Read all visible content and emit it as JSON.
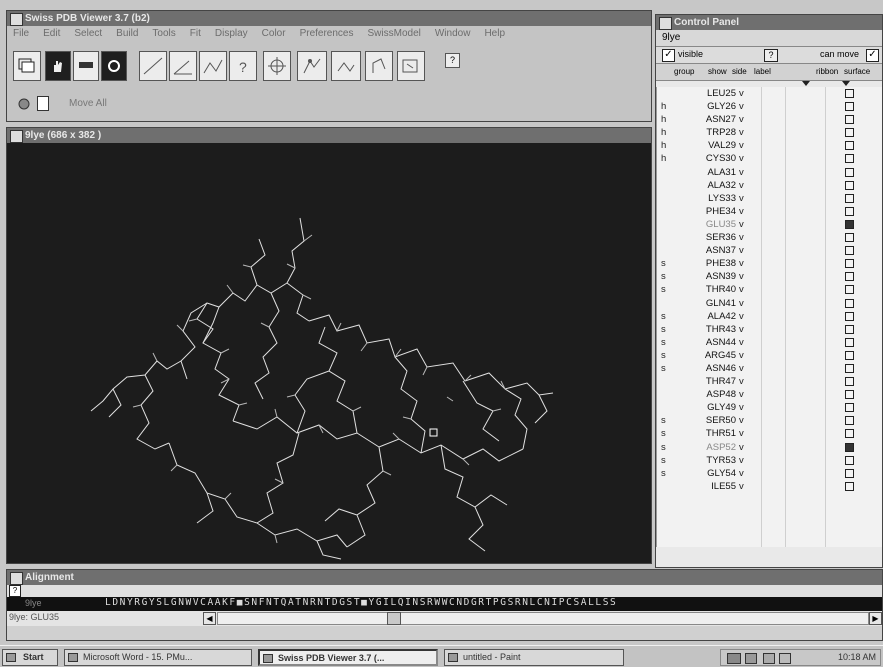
{
  "main_window": {
    "title": "Swiss PDB Viewer 3.7 (b2)",
    "menu": [
      "File",
      "Edit",
      "Select",
      "Build",
      "Tools",
      "Fit",
      "Display",
      "Color",
      "Preferences",
      "SwissModel",
      "Window",
      "Help"
    ],
    "toolbar_help": "?",
    "move_all": "Move All"
  },
  "viewer": {
    "title": "9lye  (686 x 382 )"
  },
  "control_panel": {
    "title": "Control Panel",
    "molecule": "9lye",
    "visible_label": "visible",
    "can_move_label": "can move",
    "help": "?",
    "headers": {
      "group": "group",
      "show": "show",
      "side": "side",
      "label": "label",
      "ribbon": "ribbon",
      "surface": "surface"
    },
    "rows": [
      {
        "grp": "",
        "name": "LEU25",
        "v": "v",
        "dim": false,
        "box": "empty"
      },
      {
        "grp": "h",
        "name": "GLY26",
        "v": "v",
        "dim": false,
        "box": "empty"
      },
      {
        "grp": "h",
        "name": "ASN27",
        "v": "v",
        "dim": false,
        "box": "empty"
      },
      {
        "grp": "h",
        "name": "TRP28",
        "v": "v",
        "dim": false,
        "box": "empty"
      },
      {
        "grp": "h",
        "name": "VAL29",
        "v": "v",
        "dim": false,
        "box": "empty"
      },
      {
        "grp": "h",
        "name": "CYS30",
        "v": "v",
        "dim": false,
        "box": "empty"
      },
      {
        "grp": "",
        "name": "ALA31",
        "v": "v",
        "dim": false,
        "box": "empty"
      },
      {
        "grp": "",
        "name": "ALA32",
        "v": "v",
        "dim": false,
        "box": "empty"
      },
      {
        "grp": "",
        "name": "LYS33",
        "v": "v",
        "dim": false,
        "box": "empty"
      },
      {
        "grp": "",
        "name": "PHE34",
        "v": "v",
        "dim": false,
        "box": "empty"
      },
      {
        "grp": "",
        "name": "GLU35",
        "v": "v",
        "dim": true,
        "box": "filled"
      },
      {
        "grp": "",
        "name": "SER36",
        "v": "v",
        "dim": false,
        "box": "empty"
      },
      {
        "grp": "",
        "name": "ASN37",
        "v": "v",
        "dim": false,
        "box": "empty"
      },
      {
        "grp": "s",
        "name": "PHE38",
        "v": "v",
        "dim": false,
        "box": "empty"
      },
      {
        "grp": "s",
        "name": "ASN39",
        "v": "v",
        "dim": false,
        "box": "empty"
      },
      {
        "grp": "s",
        "name": "THR40",
        "v": "v",
        "dim": false,
        "box": "empty"
      },
      {
        "grp": "",
        "name": "GLN41",
        "v": "v",
        "dim": false,
        "box": "empty"
      },
      {
        "grp": "s",
        "name": "ALA42",
        "v": "v",
        "dim": false,
        "box": "empty"
      },
      {
        "grp": "s",
        "name": "THR43",
        "v": "v",
        "dim": false,
        "box": "empty"
      },
      {
        "grp": "s",
        "name": "ASN44",
        "v": "v",
        "dim": false,
        "box": "empty"
      },
      {
        "grp": "s",
        "name": "ARG45",
        "v": "v",
        "dim": false,
        "box": "empty"
      },
      {
        "grp": "s",
        "name": "ASN46",
        "v": "v",
        "dim": false,
        "box": "empty"
      },
      {
        "grp": "",
        "name": "THR47",
        "v": "v",
        "dim": false,
        "box": "empty"
      },
      {
        "grp": "",
        "name": "ASP48",
        "v": "v",
        "dim": false,
        "box": "empty"
      },
      {
        "grp": "",
        "name": "GLY49",
        "v": "v",
        "dim": false,
        "box": "empty"
      },
      {
        "grp": "s",
        "name": "SER50",
        "v": "v",
        "dim": false,
        "box": "empty"
      },
      {
        "grp": "s",
        "name": "THR51",
        "v": "v",
        "dim": false,
        "box": "empty"
      },
      {
        "grp": "s",
        "name": "ASP52",
        "v": "v",
        "dim": true,
        "box": "filled"
      },
      {
        "grp": "s",
        "name": "TYR53",
        "v": "v",
        "dim": false,
        "box": "empty"
      },
      {
        "grp": "s",
        "name": "GLY54",
        "v": "v",
        "dim": false,
        "box": "empty"
      },
      {
        "grp": "",
        "name": "ILE55",
        "v": "v",
        "dim": false,
        "box": "empty"
      }
    ]
  },
  "alignment": {
    "title": "Alignment",
    "help": "?",
    "track_label": "9lye",
    "sequence": "LDNYRGYSLGNWVCAAKF■SNFNTQATNRNTDGST■YGILQINSRWWCNDGRTPGSRNLCNIPCSALLSS",
    "status": "9lye: GLU35"
  },
  "taskbar": {
    "start": "Start",
    "tasks": [
      "Microsoft Word - 15. PMu...",
      "Swiss PDB Viewer 3.7 (...",
      "untitled - Paint"
    ],
    "clock": "10:18 AM"
  }
}
